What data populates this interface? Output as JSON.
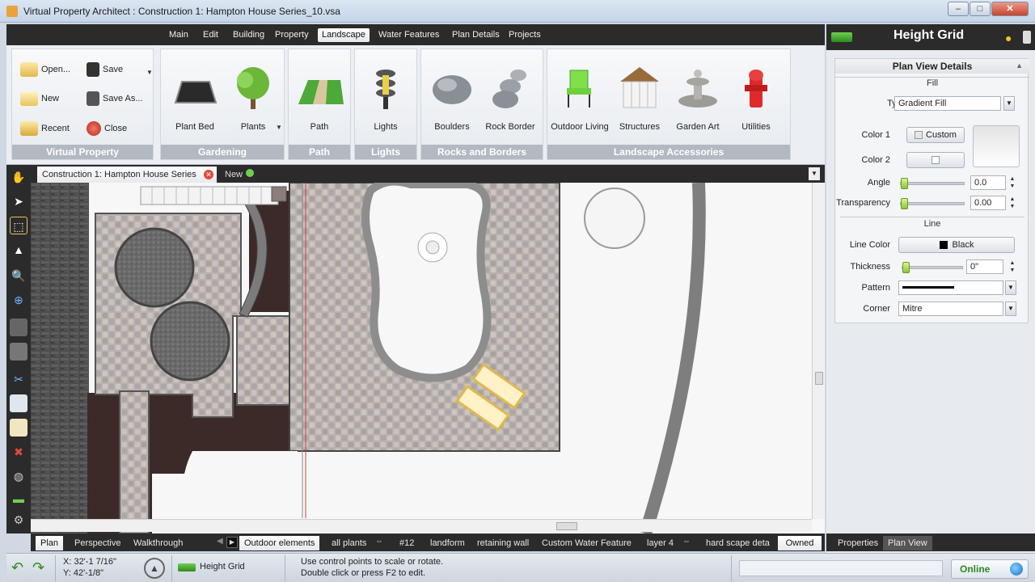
{
  "window": {
    "title": "Virtual Property Architect : Construction 1: Hampton House Series_10.vsa",
    "min_label": "–",
    "max_label": "□",
    "close_label": "✕"
  },
  "menu": {
    "tabs": [
      "Main",
      "Edit",
      "Building",
      "Property",
      "Landscape",
      "Water Features",
      "Plan Details",
      "Projects"
    ],
    "active": "Landscape"
  },
  "ribbon": {
    "virtual_property": {
      "label": "Virtual Property",
      "open": "Open...",
      "save": "Save",
      "new": "New",
      "save_as": "Save As...",
      "recent": "Recent",
      "close": "Close"
    },
    "gardening": {
      "label": "Gardening",
      "plant_bed": "Plant Bed",
      "plants": "Plants"
    },
    "path": {
      "label": "Path",
      "path": "Path"
    },
    "lights": {
      "label": "Lights",
      "lights": "Lights"
    },
    "rocks": {
      "label": "Rocks and Borders",
      "boulders": "Boulders",
      "rock_border": "Rock Border"
    },
    "accessories": {
      "label": "Landscape Accessories",
      "outdoor_living": "Outdoor Living",
      "structures": "Structures",
      "garden_art": "Garden Art",
      "utilities": "Utilities"
    }
  },
  "doc_tabs": {
    "active": "Construction 1: Hampton House Series",
    "new": "New"
  },
  "right_panel": {
    "header": "Height Grid",
    "box_title": "Plan View Details",
    "fill_section": "Fill",
    "type_label": "Type",
    "type_value": "Gradient Fill",
    "color1_label": "Color 1",
    "color1_value": "Custom",
    "color2_label": "Color 2",
    "angle_label": "Angle",
    "angle_value": "0.0",
    "angle_level": 0,
    "transparency_label": "Transparency",
    "transparency_value": "0.00",
    "transparency_level": 0,
    "line_section": "Line",
    "line_color_label": "Line Color",
    "line_color_value": "Black",
    "thickness_label": "Thickness",
    "thickness_value": "0\"",
    "thickness_level": 0,
    "pattern_label": "Pattern",
    "corner_label": "Corner",
    "corner_value": "Mitre"
  },
  "bottom_tabs": {
    "views": [
      "Plan",
      "Perspective",
      "Walkthrough"
    ],
    "active_view": "Plan",
    "layers": [
      "Outdoor elements",
      "all plants",
      "#12",
      "landform",
      "retaining wall",
      "Custom Water Feature",
      "layer 4",
      "hard scape deta"
    ],
    "active_layer": "Outdoor elements",
    "owned": "Owned",
    "panel_tabs": [
      "Properties",
      "Plan View"
    ],
    "active_panel_tab": "Plan View"
  },
  "status": {
    "x_coord": "X:  32'-1 7/16\"",
    "y_coord": "Y:  42'-1/8\"",
    "tool": "Height Grid",
    "hint_1": "Use control points to scale or rotate.",
    "hint_2": "Double click or press F2 to edit.",
    "online": "Online"
  },
  "colors": {
    "dark_bar": "#2b2b2b",
    "accent_green": "#6fcf4f",
    "paver": "#b9b2ae",
    "mulch": "#3c2a28",
    "lawn": "#f7f7f7"
  }
}
